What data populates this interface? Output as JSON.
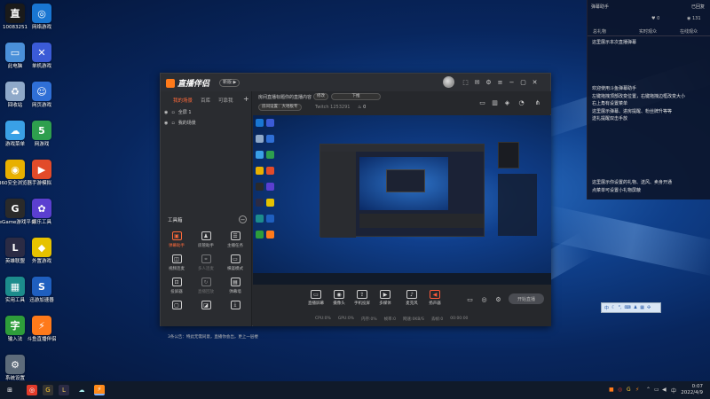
{
  "desktop": {
    "icons": [
      {
        "label": "10083251",
        "color": "#1a1a1a",
        "glyph": "直",
        "icon": "douyu-live-icon"
      },
      {
        "label": "网络游戏",
        "color": "#1976d2",
        "glyph": "◎",
        "icon": "network-game-icon"
      },
      {
        "label": "此电脑",
        "color": "#4a90d9",
        "glyph": "▭",
        "icon": "computer-icon"
      },
      {
        "label": "单机游戏",
        "color": "#3b5bd6",
        "glyph": "✕",
        "icon": "single-game-icon"
      },
      {
        "label": "回收站",
        "color": "#8fa9c9",
        "glyph": "♻",
        "icon": "recycle-bin-icon"
      },
      {
        "label": "网页游戏",
        "color": "#2f6fd6",
        "glyph": "☺",
        "icon": "web-game-icon"
      },
      {
        "label": "游戏菜单",
        "color": "#3aa0e6",
        "glyph": "☁",
        "icon": "game-menu-icon"
      },
      {
        "label": "网游戏",
        "color": "#2e9f4e",
        "glyph": "5",
        "icon": "html5-game-icon"
      },
      {
        "label": "360安全浏览器",
        "color": "#e8b000",
        "glyph": "◉",
        "icon": "browser-360-icon"
      },
      {
        "label": "手游模拟",
        "color": "#e24b2a",
        "glyph": "▶",
        "icon": "mobile-emulator-icon"
      },
      {
        "label": "WeGame游戏平台",
        "color": "#2a2a2a",
        "glyph": "G",
        "icon": "wegame-icon"
      },
      {
        "label": "娱乐工具",
        "color": "#5b3fd0",
        "glyph": "✿",
        "icon": "entertainment-icon"
      },
      {
        "label": "英雄联盟",
        "color": "#2b2b44",
        "glyph": "L",
        "icon": "lol-icon"
      },
      {
        "label": "外置游戏",
        "color": "#e6c200",
        "glyph": "◆",
        "icon": "external-game-icon"
      },
      {
        "label": "实用工具",
        "color": "#1c8c8c",
        "glyph": "▦",
        "icon": "utility-icon"
      },
      {
        "label": "迅游加速器",
        "color": "#1f5fbf",
        "glyph": "S",
        "icon": "accelerator-icon"
      },
      {
        "label": "输入法",
        "color": "#2e9d3a",
        "glyph": "字",
        "icon": "input-method-icon"
      },
      {
        "label": "斗鱼直播伴侣",
        "color": "#ff7a1a",
        "glyph": "⚡",
        "icon": "live-companion-icon"
      },
      {
        "label": "系统设置",
        "color": "#5d6b7a",
        "glyph": "⚙",
        "icon": "system-settings-icon"
      }
    ]
  },
  "app": {
    "title": "直播伴侣",
    "version_badge": "新版 ▶",
    "left_tabs": [
      "我的场景",
      "百库",
      "可靠我"
    ],
    "scenes": [
      "全屏 1",
      "我的场景"
    ],
    "tools_title": "工具箱",
    "tools": [
      {
        "label": "弹幕助手",
        "glyph": "▣"
      },
      {
        "label": "房管助手",
        "glyph": "♟"
      },
      {
        "label": "主播任务",
        "glyph": "☰"
      },
      {
        "label": "视频连麦",
        "glyph": "◫"
      },
      {
        "label": "多人连麦",
        "glyph": "⚭"
      },
      {
        "label": "横竖模式",
        "glyph": "▭"
      },
      {
        "label": "投屏器",
        "glyph": "⊡"
      },
      {
        "label": "直播回放",
        "glyph": "↻"
      },
      {
        "label": "弹幕墙",
        "glyph": "▤"
      },
      {
        "label": "",
        "glyph": "▢"
      },
      {
        "label": "",
        "glyph": "◪"
      },
      {
        "label": "",
        "glyph": "⤓"
      }
    ],
    "notice": "3条公告：特此无需同意，直播你会出，更上一层楼",
    "info": {
      "title": "房间直播标题你的直播内容",
      "tag": "修改",
      "category": "下推",
      "sub_left": "房间设置：大地板专",
      "room_id": "Twitch 1253291",
      "fans": "0"
    },
    "bottom_buttons": [
      {
        "label": "直播屏幕",
        "glyph": "▭"
      },
      {
        "label": "摄像头",
        "glyph": "◉"
      },
      {
        "label": "手机投屏",
        "glyph": "⇪"
      },
      {
        "label": "多媒体",
        "glyph": "▶"
      },
      {
        "label": "麦克风",
        "glyph": "♪"
      },
      {
        "label": "扬声器",
        "glyph": "◀"
      }
    ],
    "start_live": "开始直播",
    "stats": [
      "CPU:0%",
      "GPU:0%",
      "内存:0%",
      "帧率:0",
      "网速:0KB/S",
      "丢帧:0",
      "00:00:00"
    ]
  },
  "chat_panel": {
    "header": "弹幕助手",
    "header_right": "已回复",
    "likes": "0",
    "gifts": "131",
    "row_labels": [
      "总礼物",
      "实时观众",
      "在线观众"
    ],
    "messages_top": [
      "这里展示本次直播弹幕"
    ],
    "messages_mid": [
      "欢迎使用斗鱼弹幕助手",
      "左键拖拽顶部改变位置，右键拖拽边框改变大小",
      "右上角有设置菜单",
      "这里展示弹幕、进房提醒、粉丝牌升等等",
      "送礼提醒双击手放"
    ],
    "messages_low": [
      "这里展示你设置的礼物、送风、卖身开通",
      "点菜单可设置小礼物屏蔽"
    ]
  },
  "mini_toolbar": {
    "label": "中"
  },
  "taskbar": {
    "time": "0:07",
    "date": "2022/4/9"
  }
}
